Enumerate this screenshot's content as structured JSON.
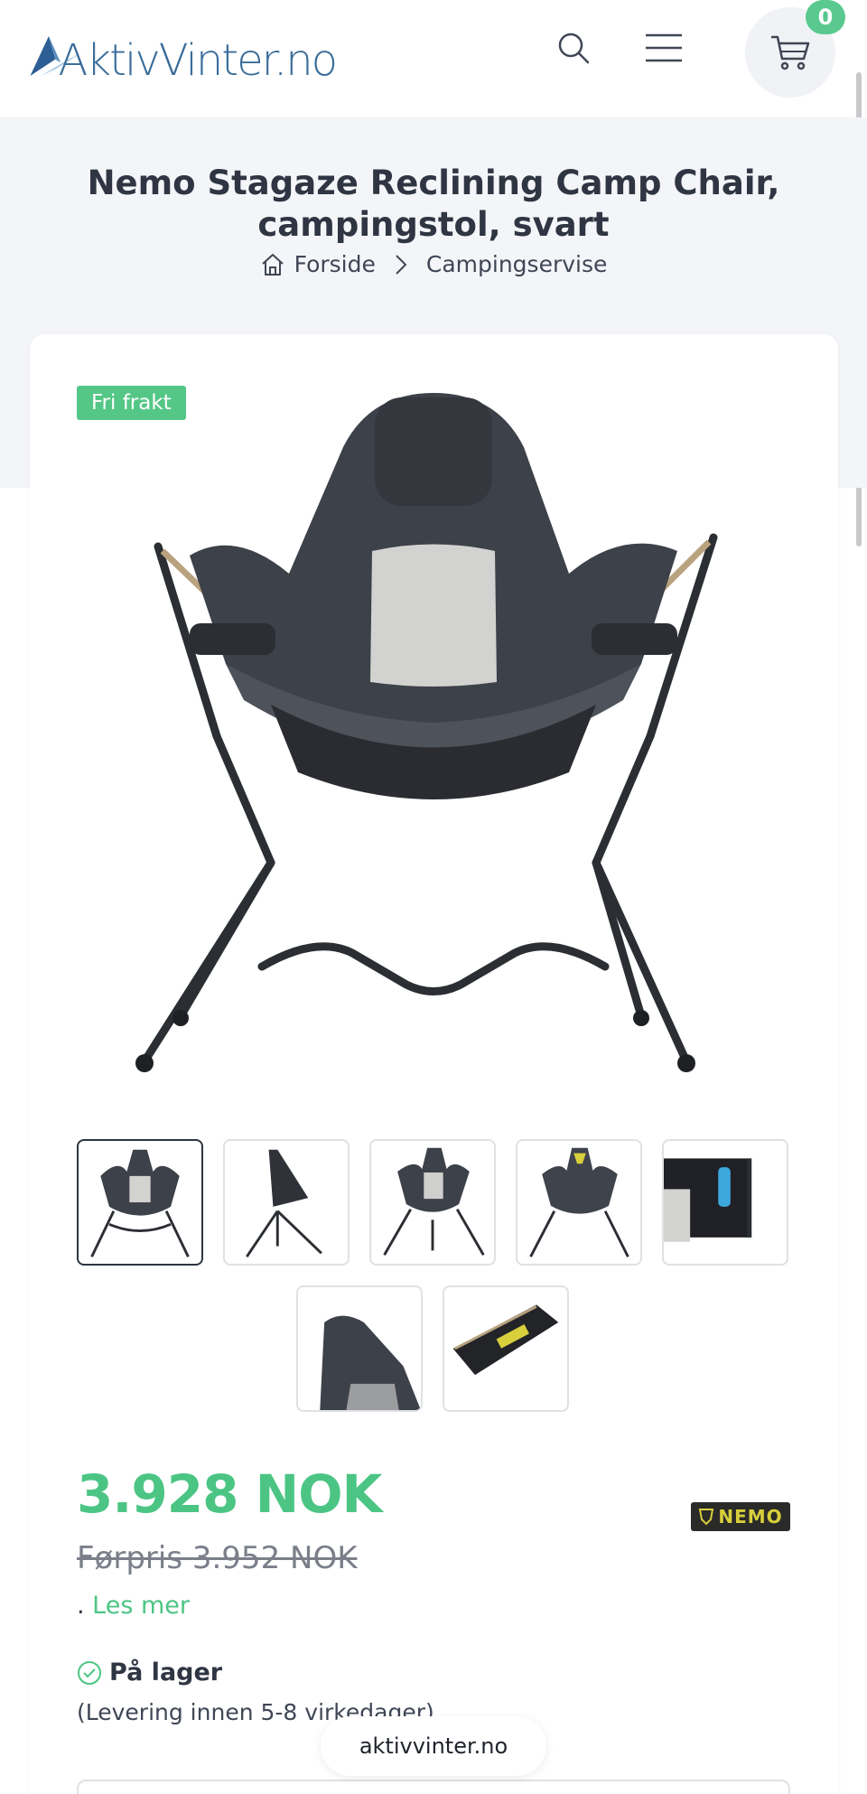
{
  "header": {
    "logo_text": "AktivVinter.no",
    "cart_count": "0",
    "icons": [
      "search-icon",
      "menu-icon",
      "cart-icon"
    ]
  },
  "product": {
    "title": "Nemo Stagaze Reclining Camp Chair, campingstol, svart",
    "badge": "Fri frakt",
    "price": "3.928 NOK",
    "old_price": "Førpris 3.952 NOK",
    "read_more_prefix": ". ",
    "read_more_label": "Les mer",
    "brand": "NEMO",
    "stock_label": "På lager",
    "delivery": "(Levering innen 5-8 virkedager)",
    "thumbnail_count": 7
  },
  "breadcrumb": {
    "home_label": "Forside",
    "current_label": "Campingservise"
  },
  "browser": {
    "url": "aktivvinter.no"
  },
  "colors": {
    "accent": "#4cc584",
    "text": "#2f3542",
    "band": "#f4f5f8"
  }
}
